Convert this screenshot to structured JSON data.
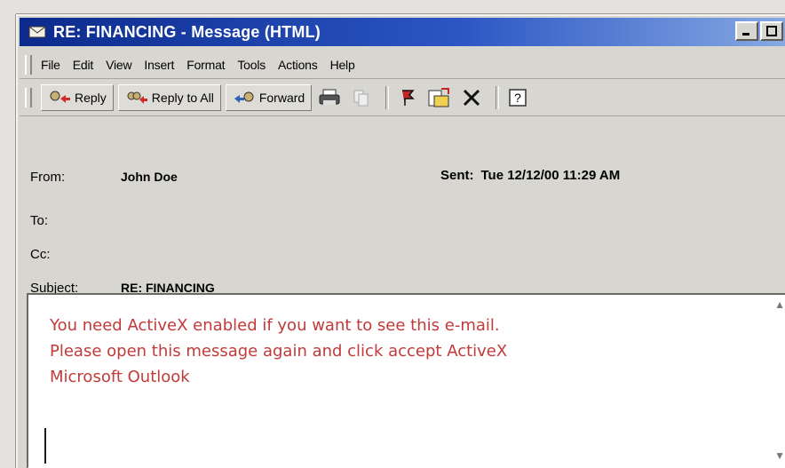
{
  "window": {
    "title": "RE: FINANCING - Message (HTML)"
  },
  "title_controls": {
    "minimize_icon": "minimize-icon",
    "maximize_icon": "maximize-icon",
    "close_icon": "close-icon"
  },
  "menu": {
    "items": [
      "File",
      "Edit",
      "View",
      "Insert",
      "Format",
      "Tools",
      "Actions",
      "Help"
    ]
  },
  "toolbar": {
    "reply_label": "Reply",
    "reply_all_label": "Reply to All",
    "forward_label": "Forward",
    "icons": [
      "print-icon",
      "copy-icon",
      "flag-icon",
      "move-icon",
      "delete-icon",
      "help-icon"
    ]
  },
  "header": {
    "from_label": "From:",
    "from_value": "John Doe",
    "sent_label": "Sent:",
    "sent_value": "Tue 12/12/00 11:29 AM",
    "to_label": "To:",
    "cc_label": "Cc:",
    "subject_label": "Subject:",
    "subject_value": "RE: FINANCING"
  },
  "body": {
    "line1": "You need ActiveX enabled if you want to see this e-mail.",
    "line2": "Please open this message again and click accept ActiveX",
    "line3": "Microsoft Outlook"
  },
  "colors": {
    "title_bar": "#0c2a8c",
    "body_text": "#c23a3a",
    "chrome": "#d8d6d0"
  }
}
